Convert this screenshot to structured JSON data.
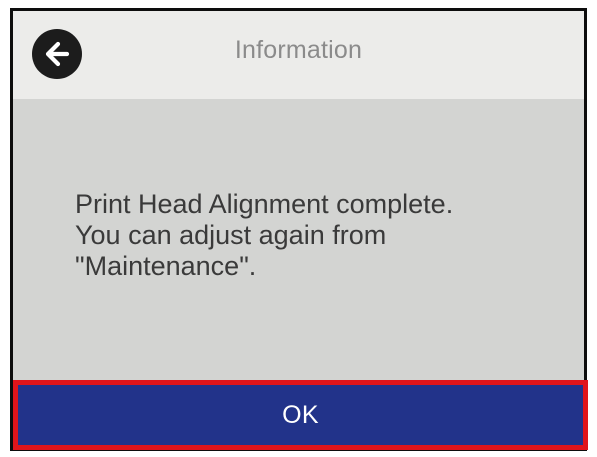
{
  "header": {
    "title": "Information",
    "back_icon": "arrow-left-icon"
  },
  "message": {
    "line1": "Print Head Alignment complete.",
    "line2": "You can adjust again from",
    "line3": "\"Maintenance\"."
  },
  "footer": {
    "ok_label": "OK"
  },
  "colors": {
    "screen_background": "#d3d4d2",
    "header_background": "#ececea",
    "ok_button": "#22338a",
    "highlight_border": "#e0151b"
  }
}
